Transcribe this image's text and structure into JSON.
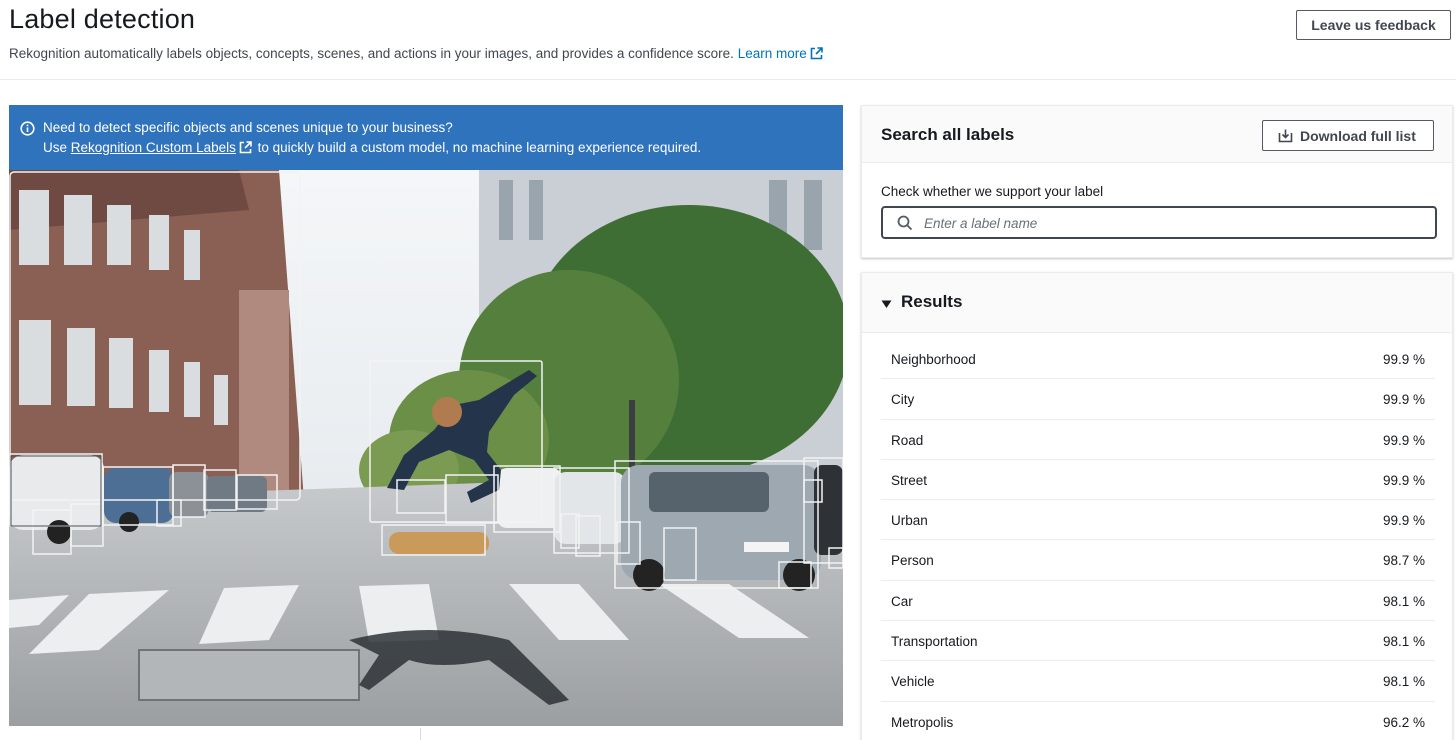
{
  "header": {
    "title": "Label detection",
    "description": "Rekognition automatically labels objects, concepts, scenes, and actions in your images, and provides a confidence score.",
    "learn_more_label": "Learn more",
    "feedback_button_label": "Leave us feedback"
  },
  "banner": {
    "line1": "Need to detect specific objects and scenes unique to your business?",
    "line2_prefix": "Use",
    "link_label": "Rekognition Custom Labels",
    "line2_suffix": "to quickly build a custom model, no machine learning experience required."
  },
  "search": {
    "title": "Search all labels",
    "download_label": "Download full list",
    "field_label": "Check whether we support your label",
    "placeholder": "Enter a label name",
    "value": ""
  },
  "results": {
    "title": "Results",
    "items": [
      {
        "name": "Neighborhood",
        "confidence": "99.9 %"
      },
      {
        "name": "City",
        "confidence": "99.9 %"
      },
      {
        "name": "Road",
        "confidence": "99.9 %"
      },
      {
        "name": "Street",
        "confidence": "99.9 %"
      },
      {
        "name": "Urban",
        "confidence": "99.9 %"
      },
      {
        "name": "Person",
        "confidence": "98.7 %"
      },
      {
        "name": "Car",
        "confidence": "98.1 %"
      },
      {
        "name": "Transportation",
        "confidence": "98.1 %"
      },
      {
        "name": "Vehicle",
        "confidence": "98.1 %"
      },
      {
        "name": "Metropolis",
        "confidence": "96.2 %"
      }
    ]
  },
  "colors": {
    "banner": "#2f73bc",
    "link": "#0073bb",
    "text": "#16191f"
  }
}
